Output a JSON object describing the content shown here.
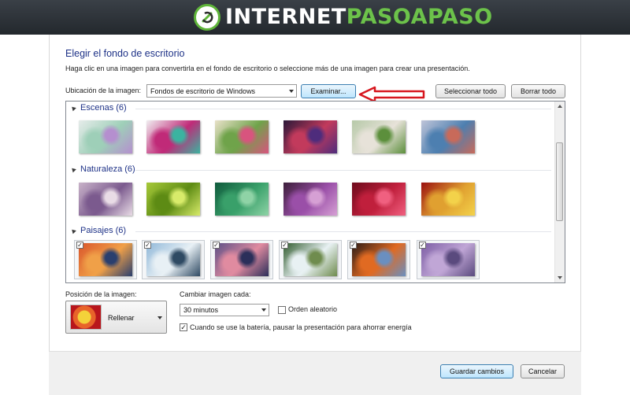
{
  "banner": {
    "brand_part1": "INTERNET",
    "brand_part2": "PASOAPASO",
    "logo_icon": "ipap-logo-icon",
    "accent": "#6cc24a"
  },
  "dialog": {
    "title": "Elegir el fondo de escritorio",
    "description": "Haga clic en una imagen para convertirla en el fondo de escritorio o seleccione más de una imagen para crear una presentación.",
    "location_label": "Ubicación de la imagen:",
    "location_value": "Fondos de escritorio de Windows",
    "browse_label": "Examinar...",
    "select_all_label": "Seleccionar todo",
    "clear_all_label": "Borrar todo",
    "arrow_color": "#d7161e"
  },
  "groups": [
    {
      "label": "Escenas (6)",
      "checked": false,
      "thumbs": [
        "#e6ecea,#9ecfb8,#b58fcf",
        "#f0eef1,#c02a78,#3bb3a0",
        "#e9e1c9,#6fa34a,#d8547e",
        "#2a1838,#c23a5c,#4e2c7c",
        "#b6c9a8,#e7e2d9,#5c8f3c",
        "#bfc4d8,#4d7fb0,#c86a5a"
      ]
    },
    {
      "label": "Naturaleza (6)",
      "checked": false,
      "thumbs": [
        "#c9b3c9,#7b5a8e,#e9dce6",
        "#a7c93a,#5d8b14,#d8eb6a",
        "#0f5a3c,#39a06a,#8fd3a6",
        "#3c1e3a,#9a4fa8,#d6a0d4",
        "#6e0b1c,#c01f3c,#f06080",
        "#9a1010,#e0a030,#f3d24a"
      ]
    },
    {
      "label": "Paisajes (6)",
      "checked": true,
      "thumbs": [
        "#d9552b,#f0a048,#2a3f6e",
        "#8fb7d8,#e8f0f5,#2f4a63",
        "#5b4f86,#e08ba0,#2b2f5a",
        "#2f5a2c,#e8f1f3,#6f8c4e",
        "#2b1b16,#e06a22,#6a8fc0",
        "#7c5da4,#c0a6d6,#5a4a7e"
      ]
    }
  ],
  "position": {
    "label": "Posición de la imagen:",
    "value": "Rellenar"
  },
  "interval": {
    "label": "Cambiar imagen cada:",
    "value": "30 minutos",
    "shuffle_label": "Orden aleatorio",
    "shuffle_checked": false,
    "battery_label": "Cuando se use la batería, pausar la presentación para ahorrar energía",
    "battery_checked": true
  },
  "footer": {
    "save_label": "Guardar cambios",
    "cancel_label": "Cancelar"
  }
}
